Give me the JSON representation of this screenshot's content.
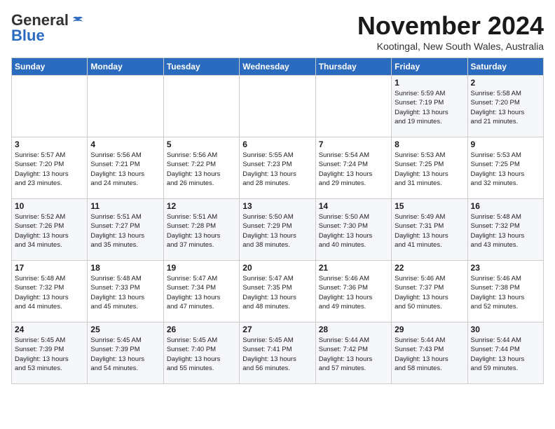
{
  "logo": {
    "line1": "General",
    "line2": "Blue"
  },
  "title": "November 2024",
  "subtitle": "Kootingal, New South Wales, Australia",
  "days_of_week": [
    "Sunday",
    "Monday",
    "Tuesday",
    "Wednesday",
    "Thursday",
    "Friday",
    "Saturday"
  ],
  "weeks": [
    [
      {
        "day": "",
        "info": ""
      },
      {
        "day": "",
        "info": ""
      },
      {
        "day": "",
        "info": ""
      },
      {
        "day": "",
        "info": ""
      },
      {
        "day": "",
        "info": ""
      },
      {
        "day": "1",
        "info": "Sunrise: 5:59 AM\nSunset: 7:19 PM\nDaylight: 13 hours\nand 19 minutes."
      },
      {
        "day": "2",
        "info": "Sunrise: 5:58 AM\nSunset: 7:20 PM\nDaylight: 13 hours\nand 21 minutes."
      }
    ],
    [
      {
        "day": "3",
        "info": "Sunrise: 5:57 AM\nSunset: 7:20 PM\nDaylight: 13 hours\nand 23 minutes."
      },
      {
        "day": "4",
        "info": "Sunrise: 5:56 AM\nSunset: 7:21 PM\nDaylight: 13 hours\nand 24 minutes."
      },
      {
        "day": "5",
        "info": "Sunrise: 5:56 AM\nSunset: 7:22 PM\nDaylight: 13 hours\nand 26 minutes."
      },
      {
        "day": "6",
        "info": "Sunrise: 5:55 AM\nSunset: 7:23 PM\nDaylight: 13 hours\nand 28 minutes."
      },
      {
        "day": "7",
        "info": "Sunrise: 5:54 AM\nSunset: 7:24 PM\nDaylight: 13 hours\nand 29 minutes."
      },
      {
        "day": "8",
        "info": "Sunrise: 5:53 AM\nSunset: 7:25 PM\nDaylight: 13 hours\nand 31 minutes."
      },
      {
        "day": "9",
        "info": "Sunrise: 5:53 AM\nSunset: 7:25 PM\nDaylight: 13 hours\nand 32 minutes."
      }
    ],
    [
      {
        "day": "10",
        "info": "Sunrise: 5:52 AM\nSunset: 7:26 PM\nDaylight: 13 hours\nand 34 minutes."
      },
      {
        "day": "11",
        "info": "Sunrise: 5:51 AM\nSunset: 7:27 PM\nDaylight: 13 hours\nand 35 minutes."
      },
      {
        "day": "12",
        "info": "Sunrise: 5:51 AM\nSunset: 7:28 PM\nDaylight: 13 hours\nand 37 minutes."
      },
      {
        "day": "13",
        "info": "Sunrise: 5:50 AM\nSunset: 7:29 PM\nDaylight: 13 hours\nand 38 minutes."
      },
      {
        "day": "14",
        "info": "Sunrise: 5:50 AM\nSunset: 7:30 PM\nDaylight: 13 hours\nand 40 minutes."
      },
      {
        "day": "15",
        "info": "Sunrise: 5:49 AM\nSunset: 7:31 PM\nDaylight: 13 hours\nand 41 minutes."
      },
      {
        "day": "16",
        "info": "Sunrise: 5:48 AM\nSunset: 7:32 PM\nDaylight: 13 hours\nand 43 minutes."
      }
    ],
    [
      {
        "day": "17",
        "info": "Sunrise: 5:48 AM\nSunset: 7:32 PM\nDaylight: 13 hours\nand 44 minutes."
      },
      {
        "day": "18",
        "info": "Sunrise: 5:48 AM\nSunset: 7:33 PM\nDaylight: 13 hours\nand 45 minutes."
      },
      {
        "day": "19",
        "info": "Sunrise: 5:47 AM\nSunset: 7:34 PM\nDaylight: 13 hours\nand 47 minutes."
      },
      {
        "day": "20",
        "info": "Sunrise: 5:47 AM\nSunset: 7:35 PM\nDaylight: 13 hours\nand 48 minutes."
      },
      {
        "day": "21",
        "info": "Sunrise: 5:46 AM\nSunset: 7:36 PM\nDaylight: 13 hours\nand 49 minutes."
      },
      {
        "day": "22",
        "info": "Sunrise: 5:46 AM\nSunset: 7:37 PM\nDaylight: 13 hours\nand 50 minutes."
      },
      {
        "day": "23",
        "info": "Sunrise: 5:46 AM\nSunset: 7:38 PM\nDaylight: 13 hours\nand 52 minutes."
      }
    ],
    [
      {
        "day": "24",
        "info": "Sunrise: 5:45 AM\nSunset: 7:39 PM\nDaylight: 13 hours\nand 53 minutes."
      },
      {
        "day": "25",
        "info": "Sunrise: 5:45 AM\nSunset: 7:39 PM\nDaylight: 13 hours\nand 54 minutes."
      },
      {
        "day": "26",
        "info": "Sunrise: 5:45 AM\nSunset: 7:40 PM\nDaylight: 13 hours\nand 55 minutes."
      },
      {
        "day": "27",
        "info": "Sunrise: 5:45 AM\nSunset: 7:41 PM\nDaylight: 13 hours\nand 56 minutes."
      },
      {
        "day": "28",
        "info": "Sunrise: 5:44 AM\nSunset: 7:42 PM\nDaylight: 13 hours\nand 57 minutes."
      },
      {
        "day": "29",
        "info": "Sunrise: 5:44 AM\nSunset: 7:43 PM\nDaylight: 13 hours\nand 58 minutes."
      },
      {
        "day": "30",
        "info": "Sunrise: 5:44 AM\nSunset: 7:44 PM\nDaylight: 13 hours\nand 59 minutes."
      }
    ]
  ]
}
